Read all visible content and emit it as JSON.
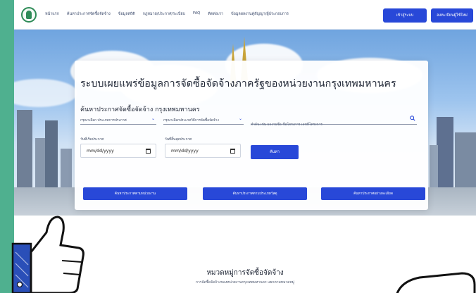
{
  "header": {
    "nav": [
      "หน้าแรก",
      "ค้นหาประกาศจัดซื้อจัดจ้าง",
      "ข้อมูลสถิติ",
      "กฎหมาย/ประกาศ/ระเบียบ",
      "FAQ",
      "ติดต่อเรา",
      "ข้อมูลผลงานคู่สัญญา/ผู้ประกอบการ"
    ],
    "login_label": "เข้าสู่ระบบ",
    "register_label": "ลงทะเบียนผู้ใช้ใหม่"
  },
  "search_panel": {
    "title": "ระบบเผยแพร่ข้อมูลการจัดซื้อจัดจ้างภาครัฐของหน่วยงานกรุงเทพมหานคร",
    "subtitle": "ค้นหาประกาศจัดซื้อจัดจ้าง กรุงเทพมหานคร",
    "select_type": "กรุณาเลือก ประเภทการประกาศ",
    "select_method": "กรุณาเลือกประเภทวิธีการจัดซื้อจัดจ้าง",
    "keyword_placeholder": "คำค้น เช่น ผลงานชื่อ ชื่อโครงการ เลขที่โครงการ",
    "start_date_label": "วันที่เริ่มประกาศ",
    "end_date_label": "วันที่สิ้นสุดประกาศ",
    "date_placeholder": "mm/dd/yyyy",
    "search_label": "ค้นหา",
    "category_buttons": [
      "ค้นหาประกาศตามหน่วยงาน",
      "ค้นหาประกาศตามประเภทวัสดุ",
      "ค้นหาประกาศอย่างละเอียด"
    ]
  },
  "section": {
    "title": "หมวดหมู่การจัดซื้อจัดจ้าง",
    "subtitle": "การจัดซื้อจัดจ้างของหน่วยงานกรุงเทพมหานคร แยกตามหมวดหมู่"
  },
  "colors": {
    "primary": "#2848d8",
    "frame": "#4fb08f",
    "text": "#1d2433"
  },
  "icons": [
    "logo-icon",
    "search-icon",
    "calendar-icon",
    "chevron-down-icon",
    "thumbs-up-icon"
  ]
}
